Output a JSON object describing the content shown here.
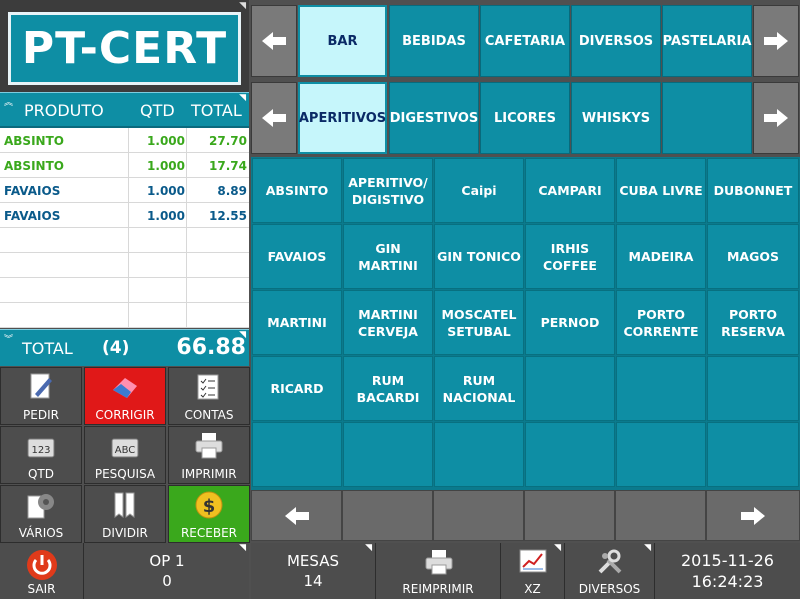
{
  "logo": {
    "text": "PT-CERT"
  },
  "order": {
    "headers": {
      "product": "PRODUTO",
      "qty": "QTD",
      "total": "TOTAL"
    },
    "rows": [
      {
        "product": "ABSINTO",
        "qty": "1.000",
        "total": "27.70",
        "color": "#3aa81c"
      },
      {
        "product": "ABSINTO",
        "qty": "1.000",
        "total": "17.74",
        "color": "#3aa81c"
      },
      {
        "product": "FAVAIOS",
        "qty": "1.000",
        "total": "8.89",
        "color": "#0a5a8a"
      },
      {
        "product": "FAVAIOS",
        "qty": "1.000",
        "total": "12.55",
        "color": "#0a5a8a"
      }
    ],
    "total_label": "TOTAL",
    "count": "(4)",
    "total_value": "66.88"
  },
  "functions": [
    {
      "label": "PEDIR",
      "icon": "pencil-paper-icon"
    },
    {
      "label": "CORRIGIR",
      "icon": "eraser-icon"
    },
    {
      "label": "CONTAS",
      "icon": "checklist-icon"
    },
    {
      "label": "QTD",
      "icon": "keyboard-123-icon"
    },
    {
      "label": "PESQUISA",
      "icon": "keyboard-abc-icon"
    },
    {
      "label": "IMPRIMIR",
      "icon": "printer-icon"
    },
    {
      "label": "VÁRIOS",
      "icon": "gear-paper-icon"
    },
    {
      "label": "DIVIDIR",
      "icon": "receipts-icon"
    },
    {
      "label": "RECEBER",
      "icon": "dollar-coin-icon"
    }
  ],
  "bottom_left": {
    "exit_label": "SAIR",
    "operator": "OP 1",
    "operator_value": "0"
  },
  "categories_row1": [
    "BAR",
    "BEBIDAS",
    "CAFETARIA",
    "DIVERSOS",
    "PASTELARIA"
  ],
  "categories_row2": [
    "APERITIVOS",
    "DIGESTIVOS",
    "LICORES",
    "WHISKYS",
    ""
  ],
  "items": [
    "ABSINTO",
    "APERITIVO/ DIGISTIVO",
    "Caipi",
    "CAMPARI",
    "CUBA LIVRE",
    "DUBONNET",
    "FAVAIOS",
    "GIN MARTINI",
    "GIN TONICO",
    "IRHIS COFFEE",
    "MADEIRA",
    "MAGOS",
    "MARTINI",
    "MARTINI CERVEJA",
    "MOSCATEL SETUBAL",
    "PERNOD",
    "PORTO CORRENTE",
    "PORTO RESERVA",
    "RICARD",
    "RUM BACARDI",
    "RUM NACIONAL",
    "",
    "",
    "",
    "",
    "",
    "",
    "",
    "",
    ""
  ],
  "bottom_right": {
    "tables_label": "MESAS",
    "tables_value": "14",
    "reprint_label": "REIMPRIMIR",
    "xz_label": "XZ",
    "misc_label": "DIVERSOS",
    "date": "2015-11-26",
    "time": "16:24:23"
  }
}
